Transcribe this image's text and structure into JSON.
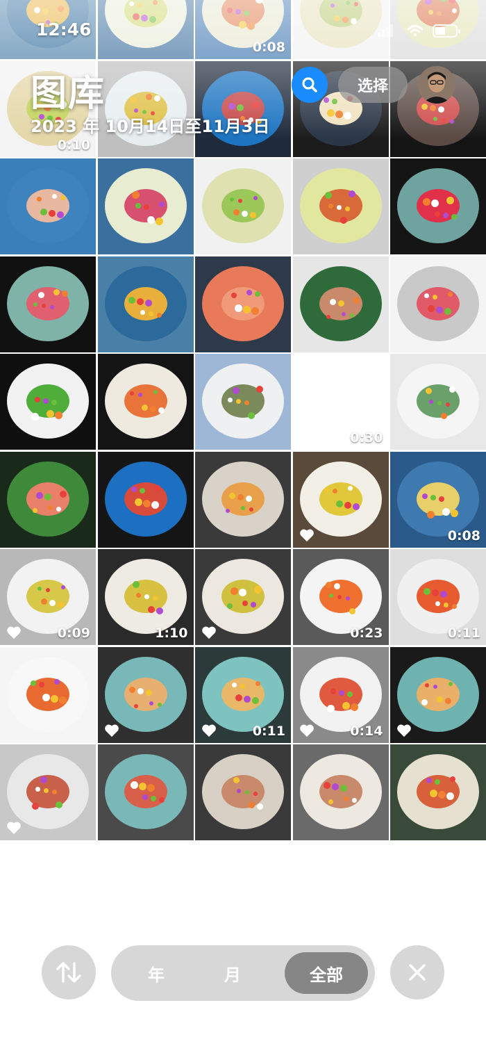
{
  "status_bar": {
    "time": "12:46"
  },
  "header": {
    "title": "图库",
    "date_range": "2023 年 10月14日至11月3日",
    "select_label": "选择"
  },
  "icons": {
    "search": "search-icon",
    "avatar": "avatar",
    "sort": "sort-arrows-icon",
    "close": "close-icon",
    "heart": "heart-icon"
  },
  "bottom_bar": {
    "year_label": "年",
    "month_label": "月",
    "all_label": "全部",
    "selected": "全部"
  },
  "colors": {
    "accent": "#1a8cff"
  },
  "grid": {
    "items": [
      {
        "bg": "#4a7fa8",
        "plate": "#2c6a9c",
        "food": "#e8b03a",
        "dur": "",
        "heart": false
      },
      {
        "bg": "#3b6f9e",
        "plate": "#e9ecd8",
        "food": "#cfd86a",
        "dur": "",
        "heart": false
      },
      {
        "bg": "#3e76b0",
        "plate": "#e6e8cf",
        "food": "#e07a4a",
        "dur": "0:08",
        "heart": false
      },
      {
        "bg": "#f1f1f1",
        "plate": "#e5e0b8",
        "food": "#b5c76a",
        "dur": "",
        "heart": false
      },
      {
        "bg": "#d8d8d8",
        "plate": "#e0e3b0",
        "food": "#d96a3e",
        "dur": "",
        "heart": false
      },
      {
        "bg": "#f3f3f3",
        "plate": "#e4d7a8",
        "food": "#c2d45c",
        "dur": "0:10",
        "heart": false
      },
      {
        "bg": "#bfbfbf",
        "plate": "#e8eef0",
        "food": "#e0c24a",
        "dur": "",
        "heart": false
      },
      {
        "bg": "#1f2a3c",
        "plate": "#1d75c2",
        "food": "#c84a4a",
        "dur": "",
        "heart": false
      },
      {
        "bg": "#1b1b1b",
        "plate": "#2b3646",
        "food": "#f1e3c0",
        "dur": "",
        "heart": false
      },
      {
        "bg": "#141414",
        "plate": "#5b4a44",
        "food": "#d24f4f",
        "dur": "",
        "heart": false
      },
      {
        "bg": "#3b7fb8",
        "plate": "#3e83bd",
        "food": "#e8b8a0",
        "dur": "",
        "heart": false
      },
      {
        "bg": "#3b6f9e",
        "plate": "#e8ecd0",
        "food": "#d85070",
        "dur": "",
        "heart": false
      },
      {
        "bg": "#f1f1f1",
        "plate": "#dfe2b0",
        "food": "#9cc85a",
        "dur": "",
        "heart": false
      },
      {
        "bg": "#cfcfcf",
        "plate": "#e2e7a0",
        "food": "#d86a3a",
        "dur": "",
        "heart": false
      },
      {
        "bg": "#151515",
        "plate": "#6fa3a0",
        "food": "#e0304a",
        "dur": "",
        "heart": false
      },
      {
        "bg": "#111111",
        "plate": "#7fb3a8",
        "food": "#e06070",
        "dur": "",
        "heart": false
      },
      {
        "bg": "#4a7fa8",
        "plate": "#2c6a9c",
        "food": "#e8b03a",
        "dur": "",
        "heart": false
      },
      {
        "bg": "#2e3a4a",
        "plate": "#e87a5a",
        "food": "#f09a7a",
        "dur": "",
        "heart": false
      },
      {
        "bg": "#e6e6e6",
        "plate": "#2f6a3a",
        "food": "#c88a6a",
        "dur": "",
        "heart": false
      },
      {
        "bg": "#f4f4f4",
        "plate": "#c9c9c9",
        "food": "#e05a6a",
        "dur": "",
        "heart": false
      },
      {
        "bg": "#0f0f0f",
        "plate": "#f2f2f2",
        "food": "#4fae3a",
        "dur": "",
        "heart": false
      },
      {
        "bg": "#141414",
        "plate": "#efeae0",
        "food": "#e8743a",
        "dur": "",
        "heart": false
      },
      {
        "bg": "#9fb7d6",
        "plate": "#eef0f2",
        "food": "#7a8a5a",
        "dur": "",
        "heart": false
      },
      {
        "bg": "#ffffff",
        "plate": "#ffffff",
        "food": "#ffffff",
        "dur": "0:30",
        "heart": false
      },
      {
        "bg": "#e8e8e8",
        "plate": "#f5f5f5",
        "food": "#6aa06a",
        "dur": "",
        "heart": false
      },
      {
        "bg": "#1a2a1a",
        "plate": "#3e8a3a",
        "food": "#e8806a",
        "dur": "",
        "heart": false
      },
      {
        "bg": "#151515",
        "plate": "#1d6fc2",
        "food": "#d84a3a",
        "dur": "",
        "heart": false
      },
      {
        "bg": "#3a3a3a",
        "plate": "#d8d2c8",
        "food": "#e8a04a",
        "dur": "",
        "heart": false
      },
      {
        "bg": "#5a4a3a",
        "plate": "#f2efe6",
        "food": "#e0c83a",
        "dur": "",
        "heart": true
      },
      {
        "bg": "#2a5a8a",
        "plate": "#3e7ab0",
        "food": "#e8cf6a",
        "dur": "0:08",
        "heart": false
      },
      {
        "bg": "#b8b8b8",
        "plate": "#f2f2f2",
        "food": "#d8c84a",
        "dur": "0:09",
        "heart": true
      },
      {
        "bg": "#2a2a2a",
        "plate": "#eeebe3",
        "food": "#d8c040",
        "dur": "1:10",
        "heart": false
      },
      {
        "bg": "#3a3a3a",
        "plate": "#ece8e0",
        "food": "#d0c040",
        "dur": "",
        "heart": true
      },
      {
        "bg": "#5a5a5a",
        "plate": "#f4f4f4",
        "food": "#f07030",
        "dur": "0:23",
        "heart": false
      },
      {
        "bg": "#dedede",
        "plate": "#f0f0f0",
        "food": "#e85a30",
        "dur": "0:11",
        "heart": false
      },
      {
        "bg": "#f5f5f5",
        "plate": "#f8f8f8",
        "food": "#e86a30",
        "dur": "",
        "heart": false
      },
      {
        "bg": "#2f2f2f",
        "plate": "#78b8b8",
        "food": "#e8b070",
        "dur": "",
        "heart": true
      },
      {
        "bg": "#2c3a3a",
        "plate": "#7ec3c0",
        "food": "#e8b868",
        "dur": "0:11",
        "heart": true
      },
      {
        "bg": "#8a8a8a",
        "plate": "#f2f2f2",
        "food": "#e05a40",
        "dur": "0:14",
        "heart": true
      },
      {
        "bg": "#1a1a1a",
        "plate": "#6fb3b0",
        "food": "#e8b068",
        "dur": "",
        "heart": true
      },
      {
        "bg": "#c8c8c8",
        "plate": "#e8e8e8",
        "food": "#c8604a",
        "dur": "",
        "heart": true
      },
      {
        "bg": "#4a4a4a",
        "plate": "#7ab8b8",
        "food": "#d8604a",
        "dur": "",
        "heart": false
      },
      {
        "bg": "#3a3a3a",
        "plate": "#d8d0c4",
        "food": "#c88a6a",
        "dur": "",
        "heart": false
      },
      {
        "bg": "#6a6a6a",
        "plate": "#ede8e0",
        "food": "#c88a6a",
        "dur": "",
        "heart": false
      },
      {
        "bg": "#3a4a3a",
        "plate": "#e6e0d0",
        "food": "#d8603a",
        "dur": "",
        "heart": false
      }
    ]
  }
}
